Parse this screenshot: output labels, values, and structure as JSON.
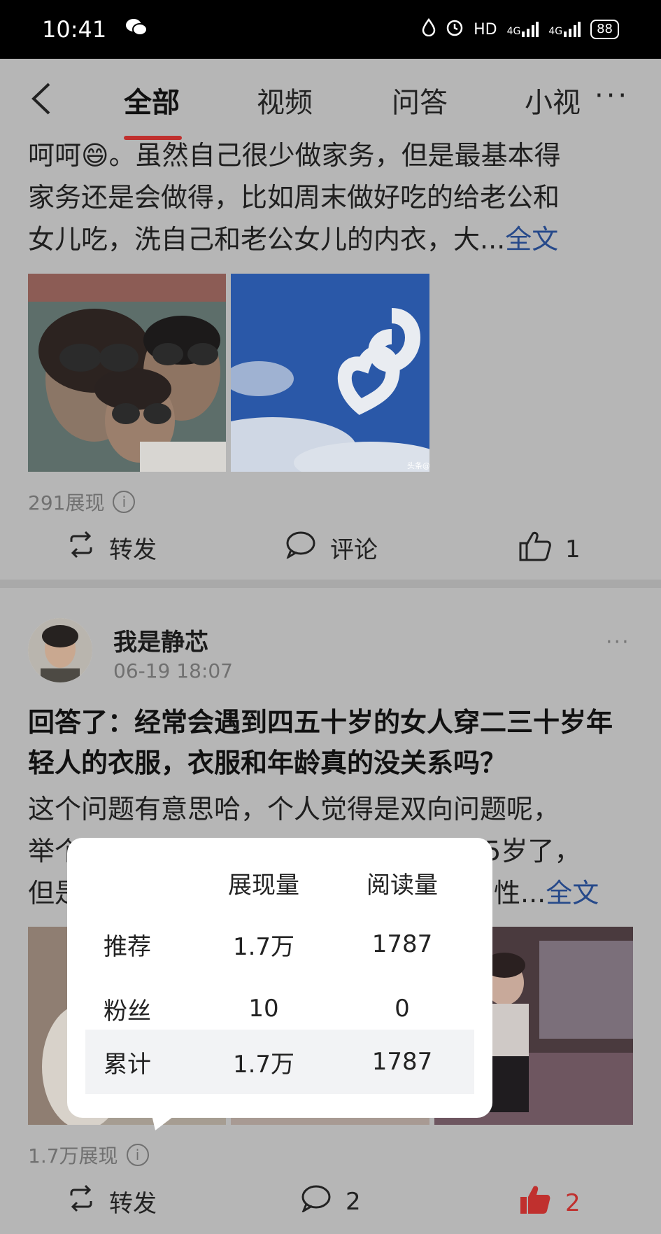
{
  "status_bar": {
    "time": "10:41",
    "right_text": "HD",
    "network_1": "4G",
    "network_2": "4G",
    "battery": "88"
  },
  "nav": {
    "tabs": [
      "全部",
      "视频",
      "问答",
      "小视"
    ],
    "active_tab": "全部"
  },
  "post1": {
    "text_line1": "呵呵😄。虽然自己很少做家务，但是最基本得",
    "text_line2": "家务还是会做得，比如周末做好吃的给老公和",
    "text_line3": "女儿吃，洗自己和老公女儿的内衣，大...",
    "full_text_link": "全文",
    "impressions": "291展现",
    "repost_label": "转发",
    "comment_label": "评论",
    "like_count": "1",
    "image2_watermark": "头条@"
  },
  "post2": {
    "username": "我是静芯",
    "time": "06-19 18:07",
    "question": "回答了：经常会遇到四五十岁的女人穿二三十岁年轻人的衣服，衣服和年龄真的没关系吗？",
    "text_line1": "这个问题有意思哈，个人觉得是双向问题呢，",
    "text_line2_visible": "举个",
    "text_line2_tail": "55岁了，",
    "text_line3_visible": "但是",
    "text_line3_tail": "的性...",
    "full_text_link": "全文",
    "impressions": "1.7万展现",
    "repost_label": "转发",
    "comment_count": "2",
    "like_count": "2"
  },
  "popup": {
    "header_impressions": "展现量",
    "header_reads": "阅读量",
    "rows": [
      {
        "label": "推荐",
        "impressions": "1.7万",
        "reads": "1787"
      },
      {
        "label": "粉丝",
        "impressions": "10",
        "reads": "0"
      },
      {
        "label": "累计",
        "impressions": "1.7万",
        "reads": "1787"
      }
    ]
  },
  "colors": {
    "accent": "#c0302e",
    "link": "#26498a",
    "like_active": "#c0302e"
  }
}
